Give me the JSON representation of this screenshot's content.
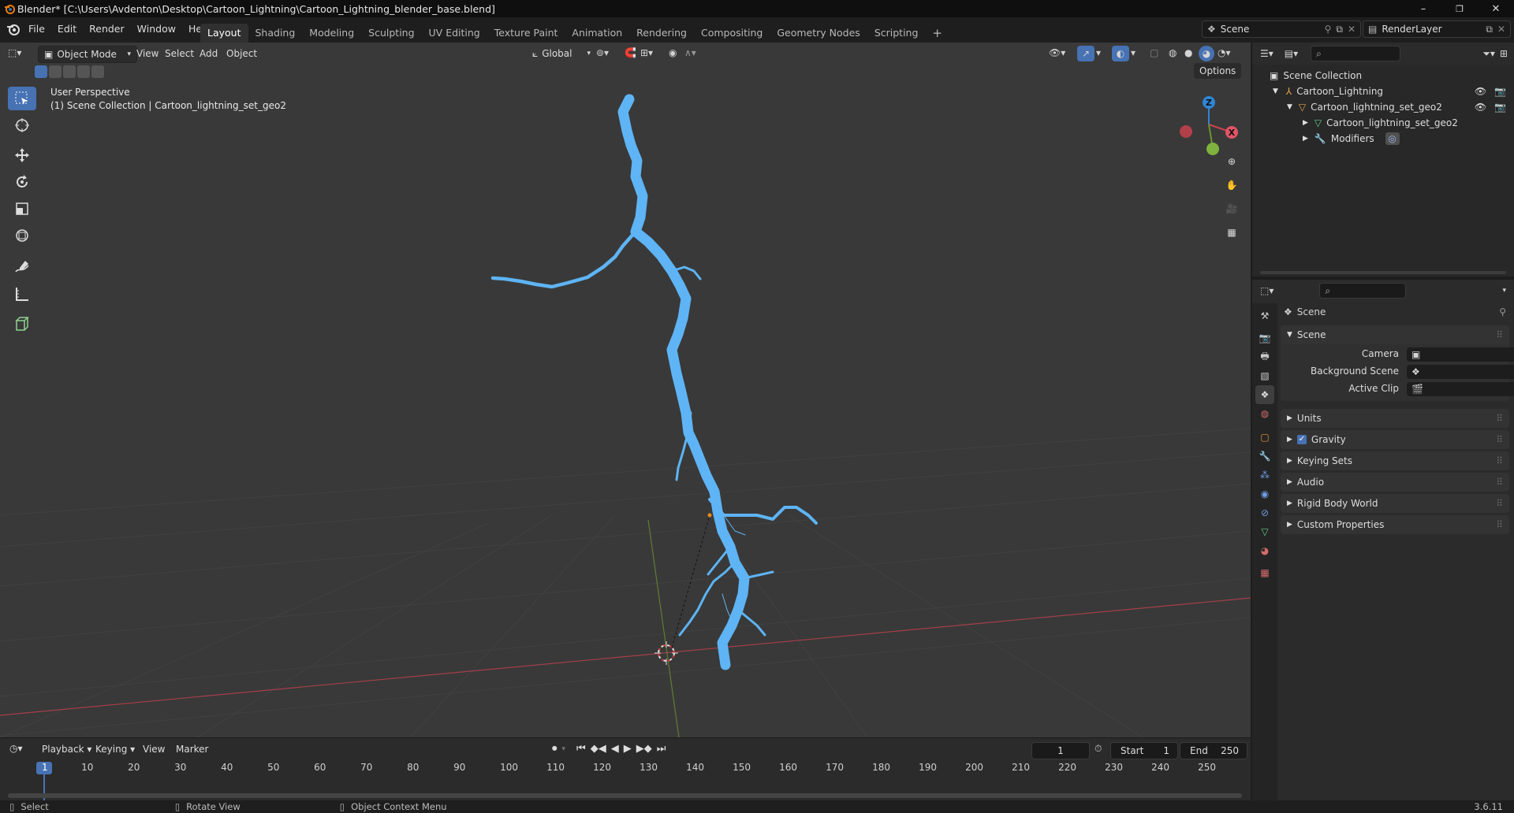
{
  "window": {
    "title": "Blender* [C:\\Users\\Avdenton\\Desktop\\Cartoon_Lightning\\Cartoon_Lightning_blender_base.blend]",
    "minimize": "–",
    "maximize": "❐",
    "close": "✕"
  },
  "menu": [
    "File",
    "Edit",
    "Render",
    "Window",
    "Help"
  ],
  "workspaces": [
    "Layout",
    "Shading",
    "Modeling",
    "Sculpting",
    "UV Editing",
    "Texture Paint",
    "Animation",
    "Rendering",
    "Compositing",
    "Geometry Nodes",
    "Scripting"
  ],
  "workspace_add": "+",
  "scene_selector": "Scene",
  "view_layer": "RenderLayer",
  "viewport": {
    "mode": "Object Mode",
    "menus": [
      "View",
      "Select",
      "Add",
      "Object"
    ],
    "transform_orientation": "Global",
    "options": "Options",
    "perspective": "User Perspective",
    "collection_info": "(1) Scene Collection | Cartoon_lightning_set_geo2",
    "gizmo": {
      "z": "Z",
      "x": "X"
    }
  },
  "timeline": {
    "menus": [
      "Playback",
      "Keying",
      "View",
      "Marker"
    ],
    "current_frame": "1",
    "start_label": "Start",
    "start": "1",
    "end_label": "End",
    "end": "250",
    "ruler": [
      "1",
      "10",
      "20",
      "30",
      "40",
      "50",
      "60",
      "70",
      "80",
      "90",
      "100",
      "110",
      "120",
      "130",
      "140",
      "150",
      "160",
      "170",
      "180",
      "190",
      "200",
      "210",
      "220",
      "230",
      "240",
      "250"
    ]
  },
  "status": {
    "select": "Select",
    "rotate": "Rotate View",
    "context": "Object Context Menu",
    "version": "3.6.11"
  },
  "outliner": {
    "root": "Scene Collection",
    "items": [
      {
        "label": "Cartoon_Lightning"
      },
      {
        "label": "Cartoon_lightning_set_geo2"
      },
      {
        "label": "Cartoon_lightning_set_geo2"
      },
      {
        "label": "Modifiers"
      }
    ]
  },
  "properties": {
    "context": "Scene",
    "panel": "Scene",
    "fields": [
      {
        "label": "Camera"
      },
      {
        "label": "Background Scene"
      },
      {
        "label": "Active Clip"
      }
    ],
    "subpanels": [
      "Units",
      "Gravity",
      "Keying Sets",
      "Audio",
      "Rigid Body World",
      "Custom Properties"
    ],
    "gravity_enabled": true
  },
  "colors": {
    "accent": "#4772b3",
    "lightning": "#5eb4f5",
    "viewport_bg": "#393939",
    "x_axis": "#c8424f",
    "y_axis": "#6d9430",
    "z_gizmo": "#2f86d6"
  }
}
